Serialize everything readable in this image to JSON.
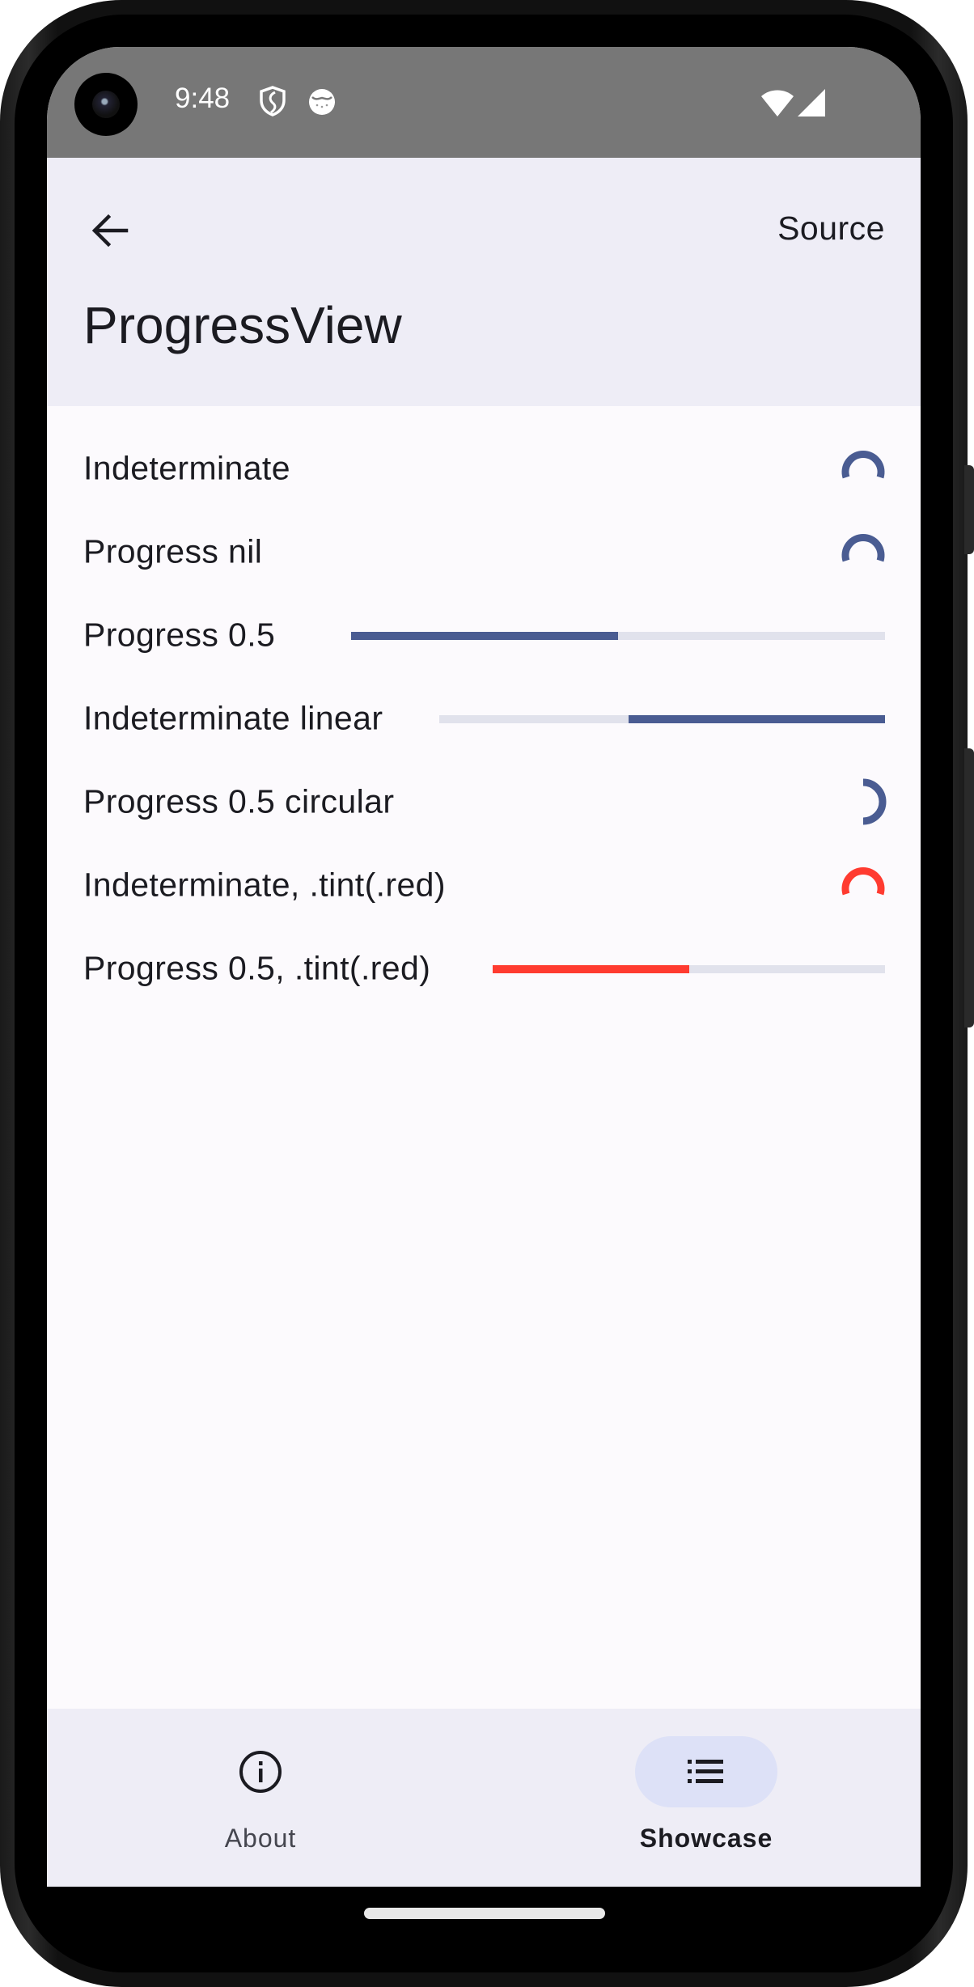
{
  "status_bar": {
    "time": "9:48",
    "icons": [
      "shield-icon",
      "app-notification-icon",
      "wifi-icon",
      "cellular-signal-icon"
    ]
  },
  "header": {
    "back_icon": "arrow-left-icon",
    "action_label": "Source",
    "title": "ProgressView"
  },
  "colors": {
    "accent": "#4A5C92",
    "red": "#FF3B30",
    "track": "#E1E2EC",
    "header_bg": "#EEEDF6",
    "content_bg": "#FCFAFD",
    "status_bar_bg": "#777777",
    "nav_active_pill": "#DDE1F7"
  },
  "rows": [
    {
      "label": "Indeterminate",
      "style": "circular",
      "indeterminate": true,
      "tint": "accent"
    },
    {
      "label": "Progress nil",
      "style": "circular",
      "indeterminate": true,
      "tint": "accent"
    },
    {
      "label": "Progress 0.5",
      "style": "linear",
      "indeterminate": false,
      "progress": 0.5,
      "tint": "accent"
    },
    {
      "label": "Indeterminate linear",
      "style": "linear",
      "indeterminate": true,
      "tint": "accent"
    },
    {
      "label": "Progress 0.5 circular",
      "style": "circular",
      "indeterminate": false,
      "progress": 0.5,
      "tint": "accent"
    },
    {
      "label": "Indeterminate, .tint(.red)",
      "style": "circular",
      "indeterminate": true,
      "tint": "red"
    },
    {
      "label": "Progress 0.5, .tint(.red)",
      "style": "linear",
      "indeterminate": false,
      "progress": 0.5,
      "tint": "red"
    }
  ],
  "nav": {
    "items": [
      {
        "label": "About",
        "icon": "info-icon",
        "selected": false
      },
      {
        "label": "Showcase",
        "icon": "list-icon",
        "selected": true
      }
    ]
  }
}
